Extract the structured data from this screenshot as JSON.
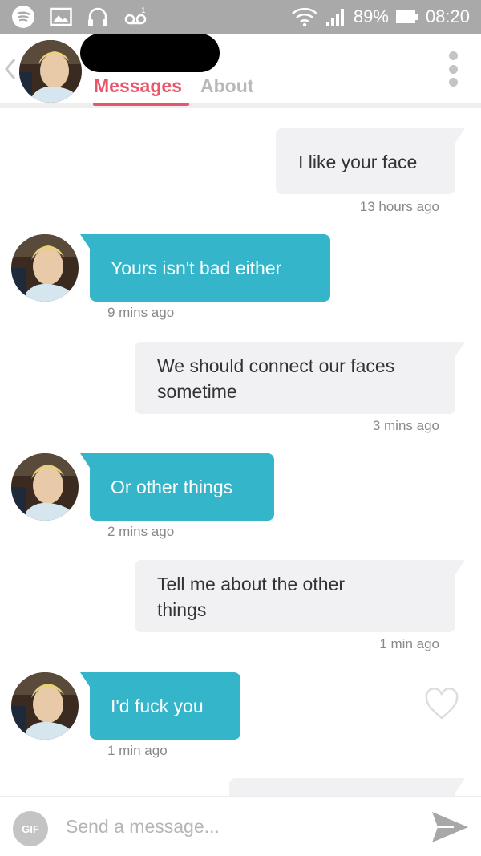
{
  "status_bar": {
    "battery": "89%",
    "time": "08:20"
  },
  "header": {
    "tabs": [
      {
        "label": "Messages",
        "active": true
      },
      {
        "label": "About",
        "active": false
      }
    ],
    "accent_color": "#e9566a"
  },
  "messages": [
    {
      "direction": "outgoing",
      "text": "I like your face",
      "time": "13 hours ago"
    },
    {
      "direction": "incoming",
      "text": "Yours isn't bad either",
      "time": "9 mins ago"
    },
    {
      "direction": "outgoing",
      "text": "We should connect our faces sometime",
      "time": "3 mins ago"
    },
    {
      "direction": "incoming",
      "text": "Or other things",
      "time": "2 mins ago"
    },
    {
      "direction": "outgoing",
      "text": "Tell me about the other things",
      "time": "1 min ago"
    },
    {
      "direction": "incoming",
      "text": "I'd fuck you",
      "time": "1 min ago"
    }
  ],
  "composer": {
    "gif_label": "GIF",
    "placeholder": "Send a message..."
  },
  "colors": {
    "incoming_bubble": "#34b5ca",
    "outgoing_bubble": "#f1f1f4"
  }
}
